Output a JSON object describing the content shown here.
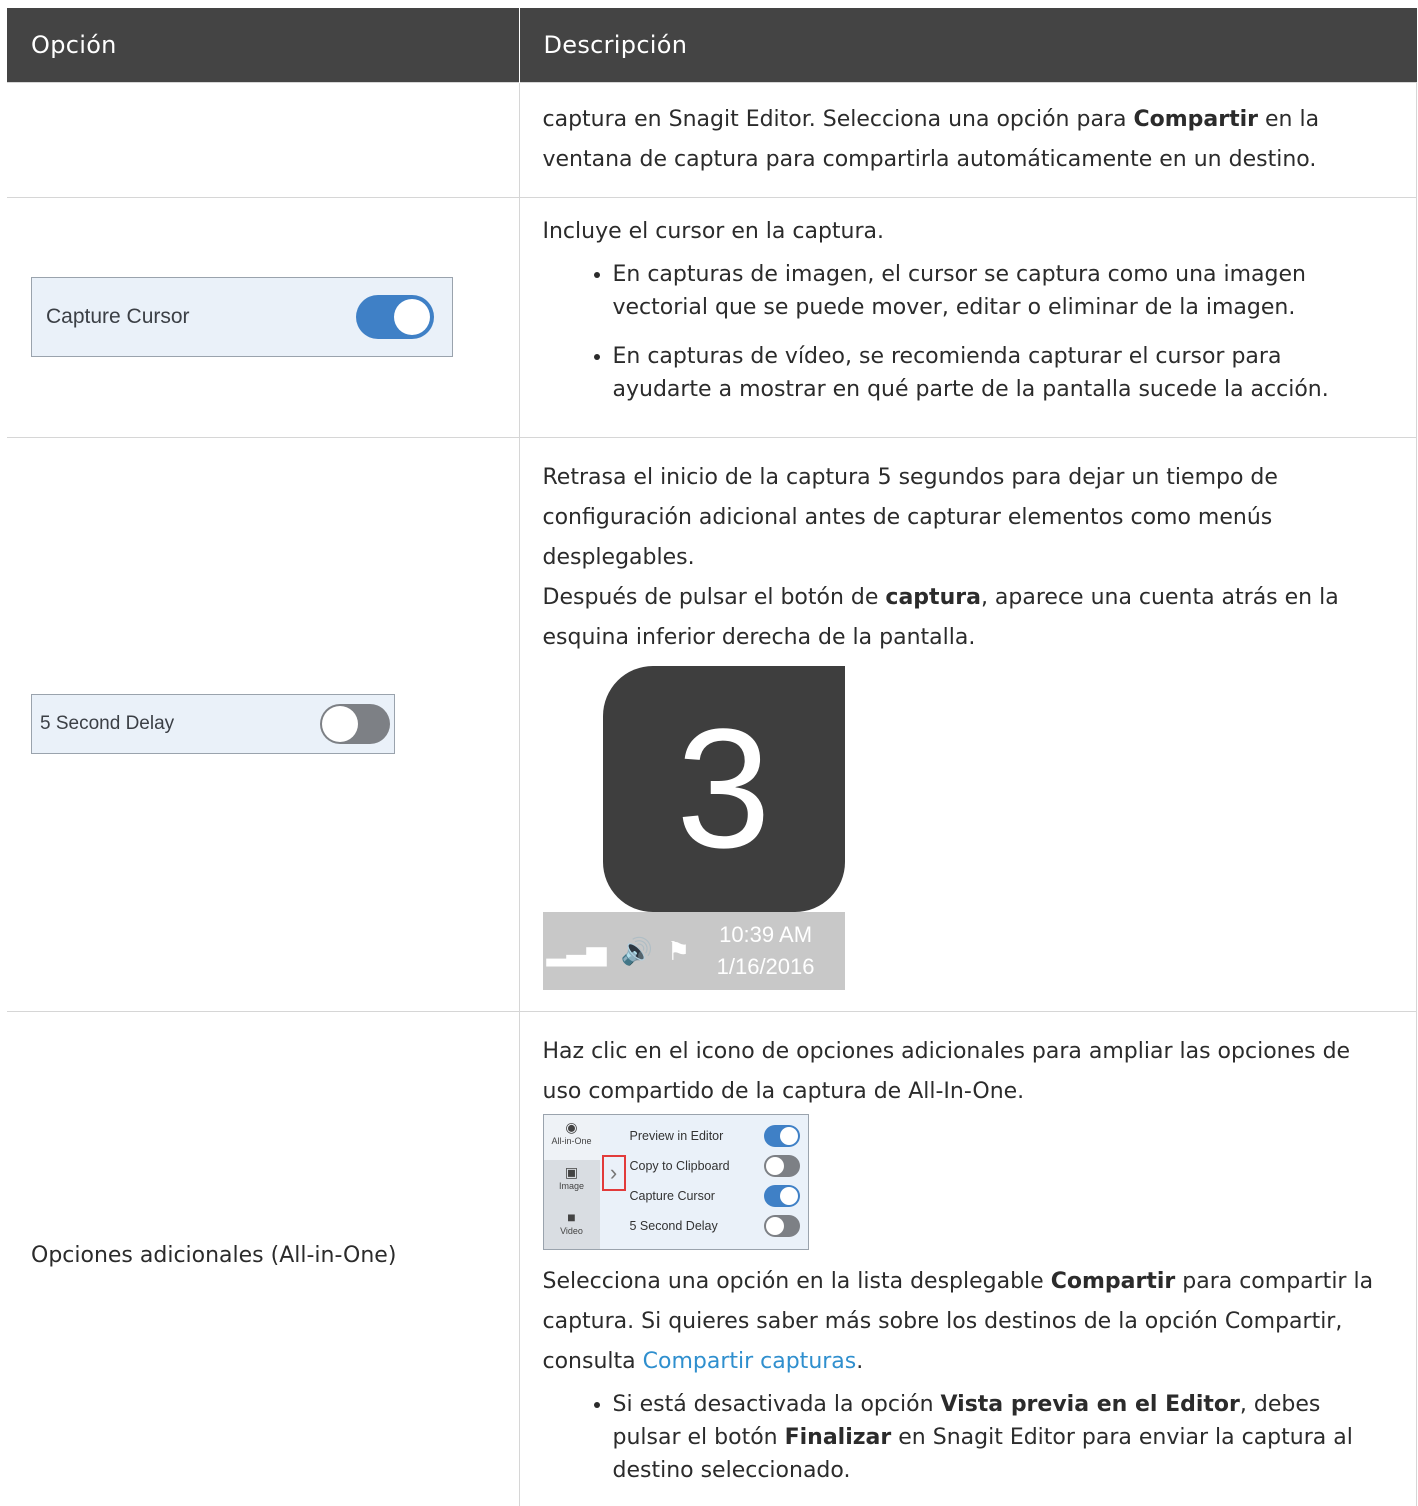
{
  "header": {
    "col1": "Opción",
    "col2": "Descripción"
  },
  "row0": {
    "text_a": "captura en Snagit Editor. Selecciona una opción para ",
    "bold_a": "Compartir",
    "text_b": " en la ventana de captura para compartirla automáticamente en un destino."
  },
  "row1": {
    "toggle_label": "Capture Cursor",
    "toggle_state": "on",
    "intro": "Incluye el cursor en la captura.",
    "bullets": [
      "En capturas de imagen, el cursor se captura como una imagen vectorial que se puede mover, editar o eliminar de la imagen.",
      "En capturas de vídeo, se recomienda capturar el cursor para ayudarte a mostrar en qué parte de la pantalla sucede la acción."
    ]
  },
  "row2": {
    "toggle_label": "5 Second Delay",
    "toggle_state": "off",
    "para1": "Retrasa el inicio de la captura 5 segundos para dejar un tiempo de configuración adicional antes de capturar elementos como menús desplegables.",
    "para2_a": "Después de pulsar el botón de ",
    "para2_bold": "captura",
    "para2_b": ", aparece una cuenta atrás en la esquina inferior derecha de la pantalla.",
    "countdown": {
      "digit": "3",
      "time": "10:39 AM",
      "date": "1/16/2016"
    }
  },
  "row3": {
    "option": "Opciones adicionales (All-in-One)",
    "para1": "Haz clic en el icono de opciones adicionales para ampliar las opciones de uso compartido de la captura de All-In-One.",
    "panel": {
      "modes": [
        "All-in-One",
        "Image",
        "Video"
      ],
      "options": [
        {
          "label": "Preview in Editor",
          "state": "on"
        },
        {
          "label": "Copy to Clipboard",
          "state": "off"
        },
        {
          "label": "Capture Cursor",
          "state": "on"
        },
        {
          "label": "5 Second Delay",
          "state": "off"
        }
      ]
    },
    "para2_a": "Selecciona una opción en la lista desplegable ",
    "para2_bold": "Compartir",
    "para2_b": " para compartir la captura. Si quieres saber más sobre los destinos de la opción Compartir, consulta ",
    "para2_link": "Compartir capturas",
    "para2_c": ".",
    "bullet_a": "Si está desactivada la opción ",
    "bullet_bold1": "Vista previa en el Editor",
    "bullet_b": ", debes pulsar el botón ",
    "bullet_bold2": "Finalizar",
    "bullet_c": " en Snagit Editor para enviar la captura al destino seleccionado."
  },
  "colors": {
    "header_bg": "#444444",
    "toggle_on": "#3f80c6",
    "toggle_off": "#7d8085",
    "link": "#2f8fce",
    "panel_bg": "#eaf1f9"
  },
  "icons": [
    "signal-icon",
    "speaker-icon",
    "flag-icon",
    "camera-icon",
    "video-icon",
    "chevron-right-icon"
  ]
}
